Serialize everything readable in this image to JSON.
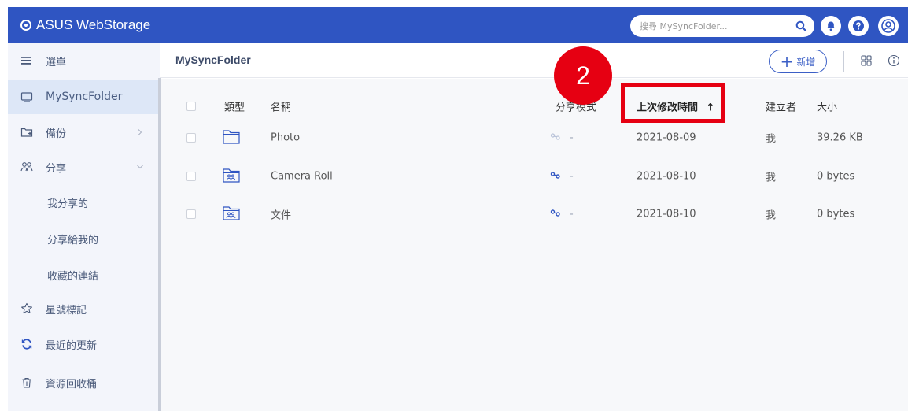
{
  "app": {
    "title": "ASUS WebStorage"
  },
  "search": {
    "placeholder": "搜尋 MySyncFolder..."
  },
  "header_icons": [
    "search-icon",
    "bell-icon",
    "help-icon",
    "user-icon"
  ],
  "sidebar": {
    "menu_label": "選單",
    "items": [
      {
        "label": "MySyncFolder",
        "icon": "monitor-icon",
        "active": true
      },
      {
        "label": "備份",
        "icon": "backup-folder-icon",
        "chevron": "right"
      },
      {
        "label": "分享",
        "icon": "people-icon",
        "chevron": "down"
      },
      {
        "label": "我分享的",
        "sub": true
      },
      {
        "label": "分享給我的",
        "sub": true
      },
      {
        "label": "收藏的連結",
        "sub": true
      },
      {
        "label": "星號標記",
        "icon": "star-icon"
      },
      {
        "label": "最近的更新",
        "icon": "refresh-icon"
      },
      {
        "label": "資源回收桶",
        "icon": "trash-icon"
      }
    ]
  },
  "main": {
    "breadcrumb": "MySyncFolder",
    "add_button_label": "新增",
    "columns": {
      "type": "類型",
      "name": "名稱",
      "share": "分享模式",
      "modified": "上次修改時間",
      "creator": "建立者",
      "size": "大小"
    },
    "sort_indicator": "↑",
    "rows": [
      {
        "type_icon": "folder-icon",
        "name": "Photo",
        "share": "-",
        "modified": "2021-08-09",
        "creator": "我",
        "size": "39.26 KB",
        "shared": false
      },
      {
        "type_icon": "shared-folder-icon",
        "name": "Camera Roll",
        "share": "-",
        "modified": "2021-08-10",
        "creator": "我",
        "size": "0 bytes",
        "shared": true
      },
      {
        "type_icon": "shared-folder-icon",
        "name": "文件",
        "share": "-",
        "modified": "2021-08-10",
        "creator": "我",
        "size": "0 bytes",
        "shared": true
      }
    ]
  },
  "annotation": {
    "step_number": "2"
  },
  "colors": {
    "topbar": "#2f55c2",
    "accent": "#3b5fc6",
    "annotation": "#e60012",
    "sidebar_bg": "#f3f5fb",
    "active_bg": "#dde7f7"
  }
}
